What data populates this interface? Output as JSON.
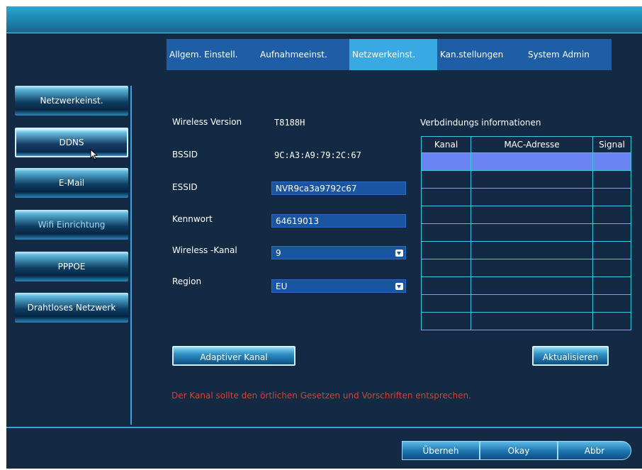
{
  "tabs": [
    {
      "label": "Allgem. Einstell."
    },
    {
      "label": "Aufnahmeeinst."
    },
    {
      "label": "Netzwerkeinst.",
      "active": true
    },
    {
      "label": "Kan.stellungen"
    },
    {
      "label": "System Admin"
    }
  ],
  "sidebar": {
    "items": [
      {
        "label": "Netzwerkeinst."
      },
      {
        "label": "DDNS",
        "selected": true
      },
      {
        "label": "E-Mail"
      },
      {
        "label": "Wifi Einrichtung"
      },
      {
        "label": "PPPOE"
      },
      {
        "label": "Drahtloses Netzwerk"
      }
    ]
  },
  "form": {
    "wireless_version_label": "Wireless Version",
    "wireless_version_value": "T8188H",
    "bssid_label": "BSSID",
    "bssid_value": "9C:A3:A9:79:2C:67",
    "essid_label": "ESSID",
    "essid_value": "NVR9ca3a9792c67",
    "password_label": "Kennwort",
    "password_value": "64619013",
    "channel_label": "Wireless -Kanal",
    "channel_value": "9",
    "region_label": "Region",
    "region_value": "EU"
  },
  "connection_info": {
    "title": "Verbdindungs informationen",
    "columns": [
      "Kanal",
      "MAC-Adresse",
      "Signal"
    ],
    "row_count": 10
  },
  "buttons": {
    "adaptive_channel": "Adaptiver Kanal",
    "refresh": "Aktualisieren",
    "apply": "Überneh",
    "ok": "Okay",
    "cancel": "Abbr"
  },
  "warning": "Der Kanal sollte den örtlichen Gesetzen und Vorschriften entsprechen.",
  "colors": {
    "background": "#142a44",
    "tab": "#1d5ea6",
    "tab_active": "#38a9e2",
    "warning": "#e53b2e",
    "selected_row": "#6b84f3"
  }
}
